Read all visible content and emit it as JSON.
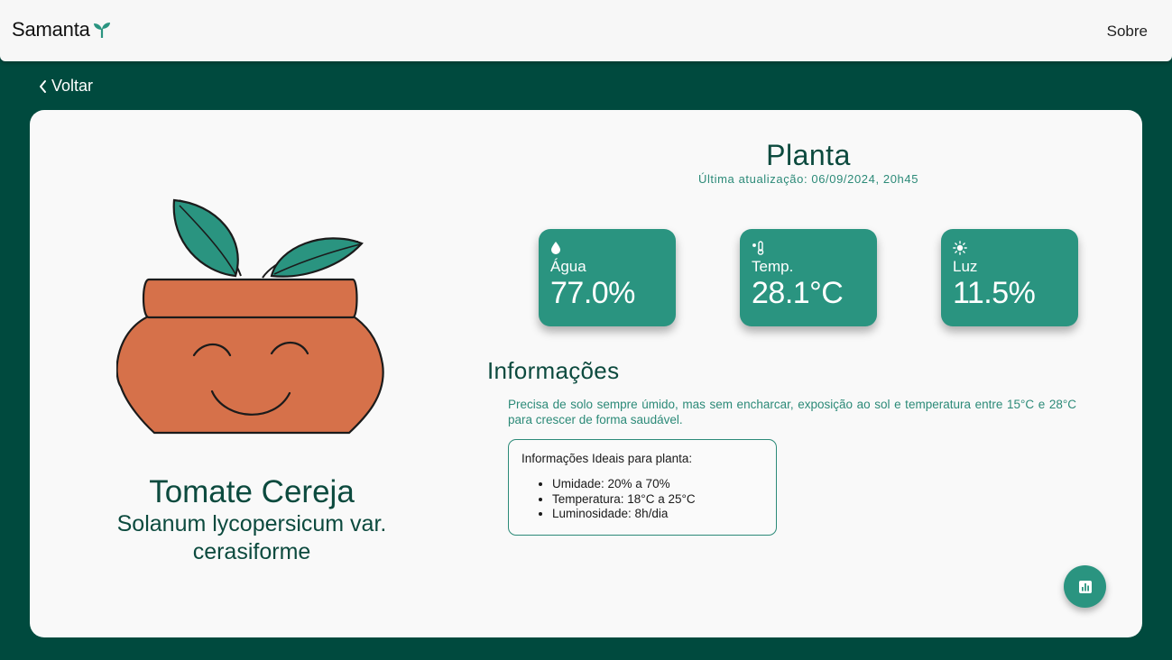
{
  "header": {
    "brand": "Samanta",
    "about_label": "Sobre"
  },
  "nav": {
    "back_label": "Voltar"
  },
  "plant": {
    "common_name": "Tomate Cereja",
    "scientific_name": "Solanum lycopersicum var. cerasiforme"
  },
  "panel": {
    "title": "Planta",
    "last_update": "Última atualização: 06/09/2024, 20h45"
  },
  "metrics": [
    {
      "icon": "water-drop-icon",
      "label": "Água",
      "value": "77.0%"
    },
    {
      "icon": "thermometer-icon",
      "label": "Temp.",
      "value": "28.1°C"
    },
    {
      "icon": "sun-icon",
      "label": "Luz",
      "value": "11.5%"
    }
  ],
  "info": {
    "title": "Informações",
    "description": "Precisa de solo sempre úmido, mas sem encharcar, exposição ao sol e temperatura entre 15°C e 28°C para crescer de forma saudável.",
    "ideal_title": "Informações Ideais para planta:",
    "ideal_items": [
      "Umidade: 20% a 70%",
      "Temperatura: 18°C a 25°C",
      "Luminosidade: 8h/dia"
    ]
  },
  "fab": {
    "icon": "bar-chart-icon"
  },
  "colors": {
    "background": "#004a3e",
    "accent": "#2a9480",
    "pot": "#d6714a",
    "leaf": "#2a9480"
  }
}
